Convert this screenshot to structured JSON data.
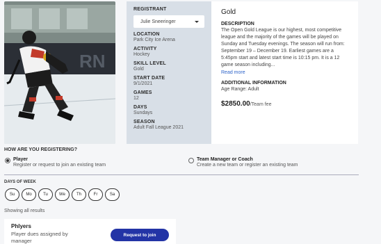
{
  "league": {
    "registrant_label": "REGISTRANT",
    "registrant_value": "Julie Sneeringer",
    "fields": [
      {
        "label": "LOCATION",
        "value": "Park City Ice Arena"
      },
      {
        "label": "ACTIVITY",
        "value": "Hockey"
      },
      {
        "label": "SKILL LEVEL",
        "value": "Gold"
      },
      {
        "label": "START DATE",
        "value": "9/1/2021"
      },
      {
        "label": "GAMES",
        "value": "12"
      },
      {
        "label": "DAYS",
        "value": "Sundays"
      },
      {
        "label": "SEASON",
        "value": "Adult Fall League 2021"
      }
    ],
    "title": "Gold",
    "description_label": "DESCRIPTION",
    "description": "The Open Gold League is our highest, most competitive league and the majority of the games will be played on Sunday and Tuesday evenings. The season will run from: September 19 – December 19. Earliest games are a 5:45pm start and latest start time is 10:15 pm. It is a 12 game season including...",
    "read_more": "Read more",
    "additional_label": "ADDITIONAL INFORMATION",
    "additional_value": "Age Range: Adult",
    "price": "$2850.00",
    "price_suffix": "/Team fee"
  },
  "registration": {
    "title": "HOW ARE YOU REGISTERING?",
    "options": [
      {
        "title": "Player",
        "subtitle": "Register or request to join an existing team",
        "selected": true
      },
      {
        "title": "Team Manager or Coach",
        "subtitle": "Create a new team or register an existing team",
        "selected": false
      }
    ]
  },
  "days_of_week": {
    "title": "DAYS OF WEEK",
    "days": [
      "Su",
      "Mo",
      "Tu",
      "We",
      "Th",
      "Fr",
      "Sa"
    ]
  },
  "results": {
    "summary": "Showing all results",
    "items": [
      {
        "name": "Phlyers",
        "detail": "Player dues assigned by manager",
        "button": "Request to join"
      }
    ]
  }
}
